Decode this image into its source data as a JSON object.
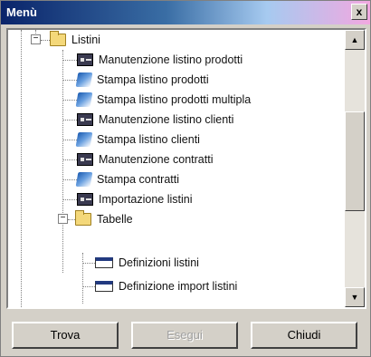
{
  "window": {
    "title": "Menù",
    "close_label": "x"
  },
  "tree": {
    "root": {
      "label": "Listini",
      "expander": "−"
    },
    "items": [
      {
        "label": "Manutenzione listino prodotti",
        "icon": "form-icon"
      },
      {
        "label": "Stampa listino prodotti",
        "icon": "print-icon"
      },
      {
        "label": "Stampa listino prodotti multipla",
        "icon": "print-icon"
      },
      {
        "label": "Manutenzione listino clienti",
        "icon": "form-icon"
      },
      {
        "label": "Stampa listino clienti",
        "icon": "print-icon"
      },
      {
        "label": "Manutenzione contratti",
        "icon": "form-icon"
      },
      {
        "label": "Stampa contratti",
        "icon": "print-icon"
      },
      {
        "label": "Importazione listini",
        "icon": "form-icon"
      }
    ],
    "sub": {
      "label": "Tabelle",
      "expander": "−"
    },
    "sub_items": [
      {
        "label": "Definizioni listini",
        "icon": "table-icon"
      },
      {
        "label": "Definizione import listini",
        "icon": "table-icon"
      }
    ]
  },
  "scrollbar": {
    "up": "▲",
    "down": "▼"
  },
  "buttons": {
    "find": "Trova",
    "execute": "Esegui",
    "close": "Chiudi"
  },
  "colors": {
    "title_start": "#0a246a",
    "title_end": "#f2a8e0",
    "face": "#d4d0c8"
  }
}
